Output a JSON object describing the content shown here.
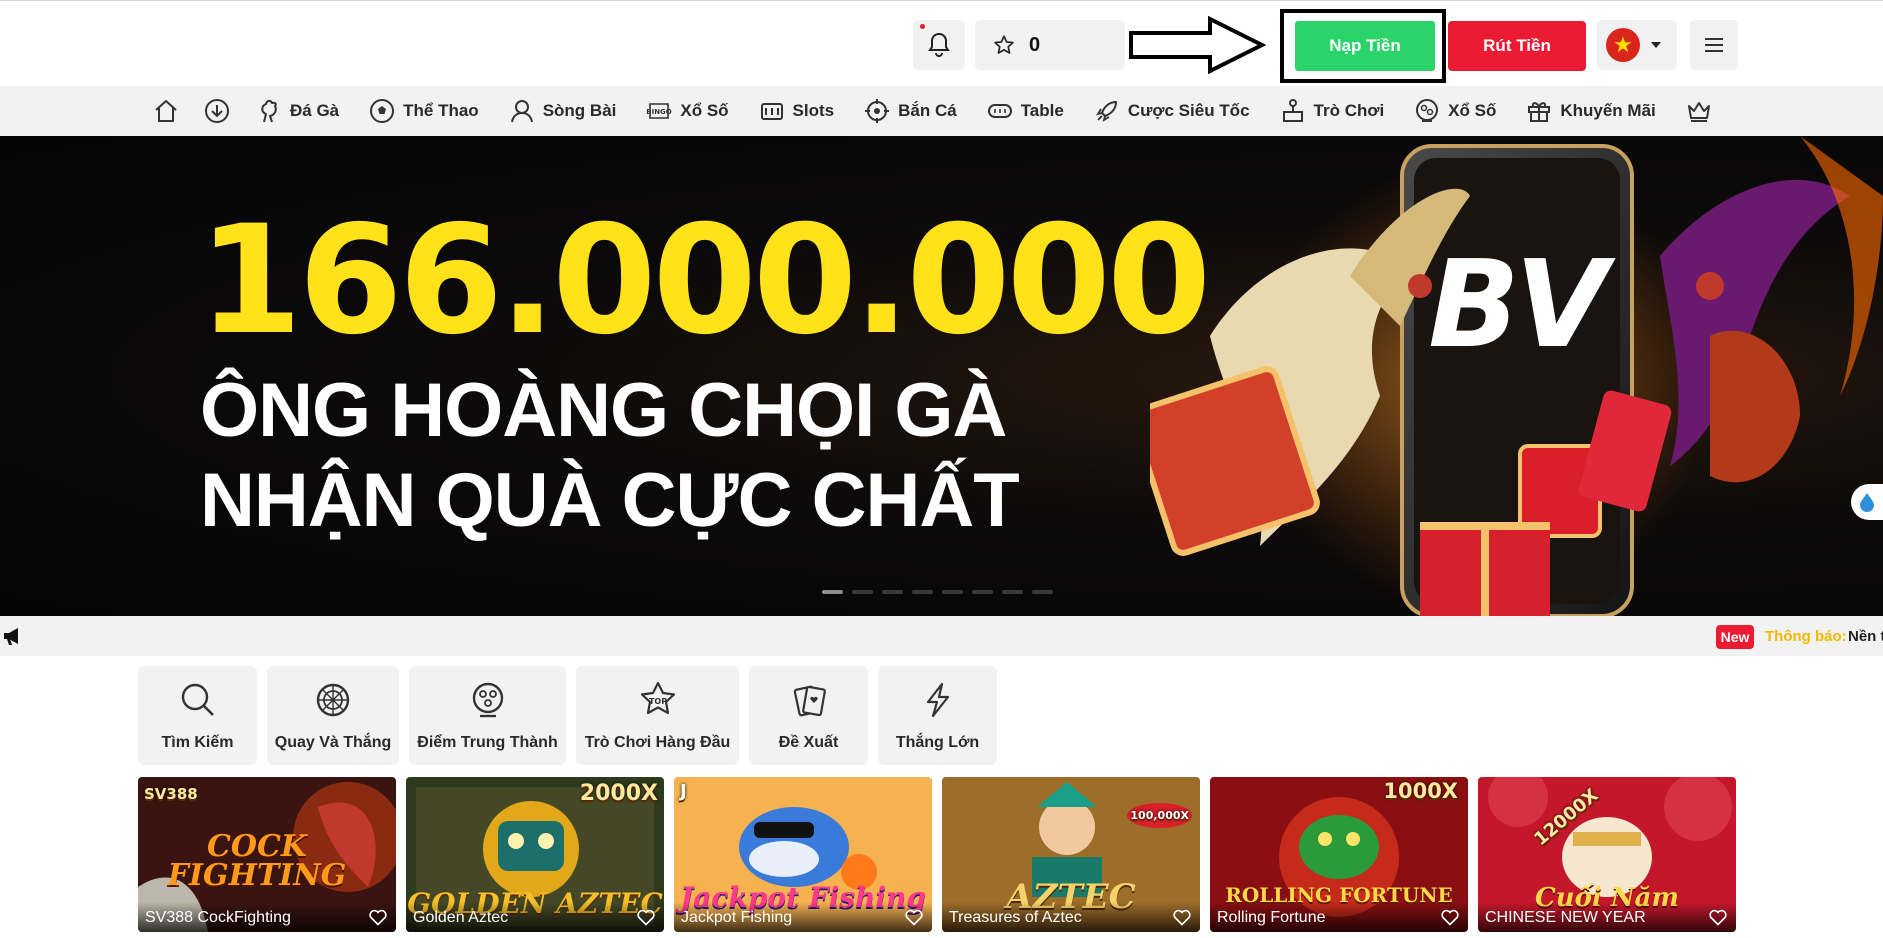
{
  "header": {
    "favorites_count": "0",
    "deposit_label": "Nạp Tiền",
    "withdraw_label": "Rút Tiền",
    "language_flag": "vietnam-flag",
    "colors": {
      "deposit": "#2bd46b",
      "withdraw": "#ea1b32",
      "highlight_frame": "#000000"
    }
  },
  "nav": {
    "items": [
      {
        "icon": "home-icon",
        "label": ""
      },
      {
        "icon": "download-icon",
        "label": ""
      },
      {
        "icon": "rooster-icon",
        "label": "Đá Gà"
      },
      {
        "icon": "soccer-ball-icon",
        "label": "Thể Thao"
      },
      {
        "icon": "dealer-icon",
        "label": "Sòng Bài"
      },
      {
        "icon": "bingo-icon",
        "label": "Xổ Số"
      },
      {
        "icon": "slot-machine-icon",
        "label": "Slots"
      },
      {
        "icon": "target-icon",
        "label": "Bắn Cá"
      },
      {
        "icon": "table-icon",
        "label": "Table"
      },
      {
        "icon": "rocket-icon",
        "label": "Cược Siêu Tốc"
      },
      {
        "icon": "arcade-icon",
        "label": "Trò Chơi"
      },
      {
        "icon": "lottery-ball-icon",
        "label": "Xổ Số"
      },
      {
        "icon": "gift-icon",
        "label": "Khuyến Mãi"
      },
      {
        "icon": "crown-icon",
        "label": ""
      }
    ]
  },
  "banner": {
    "amount": "166.000.000",
    "line1": "ÔNG HOÀNG CHỌI GÀ",
    "line2": "NHẬN QUÀ CỰC CHẤT",
    "logo": "BV",
    "slide_count": 8,
    "active_slide": 1
  },
  "notice": {
    "badge": "New",
    "label": "Thông báo:",
    "text": "Nền t"
  },
  "quick_links": [
    {
      "icon": "search-icon",
      "label": "Tìm Kiếm"
    },
    {
      "icon": "wheel-icon",
      "label": "Quay Và Thắng"
    },
    {
      "icon": "loyalty-icon",
      "label": "Điểm Trung Thành"
    },
    {
      "icon": "top-games-icon",
      "label": "Trò Chơi Hàng Đầu"
    },
    {
      "icon": "cards-icon",
      "label": "Đề Xuất"
    },
    {
      "icon": "lightning-icon",
      "label": "Thắng Lớn"
    }
  ],
  "games": [
    {
      "name": "SV388 CockFighting",
      "art": "COCK FIGHTING",
      "badge": "SV388"
    },
    {
      "name": "Golden Aztec",
      "art": "GOLDEN AZTEC",
      "badge": "2000X"
    },
    {
      "name": "Jackpot Fishing",
      "art": "Jackpot Fishing",
      "badge": "J"
    },
    {
      "name": "Treasures of Aztec",
      "art": "AZTEC",
      "badge": "100,000X"
    },
    {
      "name": "Rolling Fortune",
      "art": "ROLLING FORTUNE",
      "badge": "1000X"
    },
    {
      "name": "CHINESE NEW YEAR",
      "art": "Cuối Năm",
      "badge": "12000X"
    }
  ]
}
